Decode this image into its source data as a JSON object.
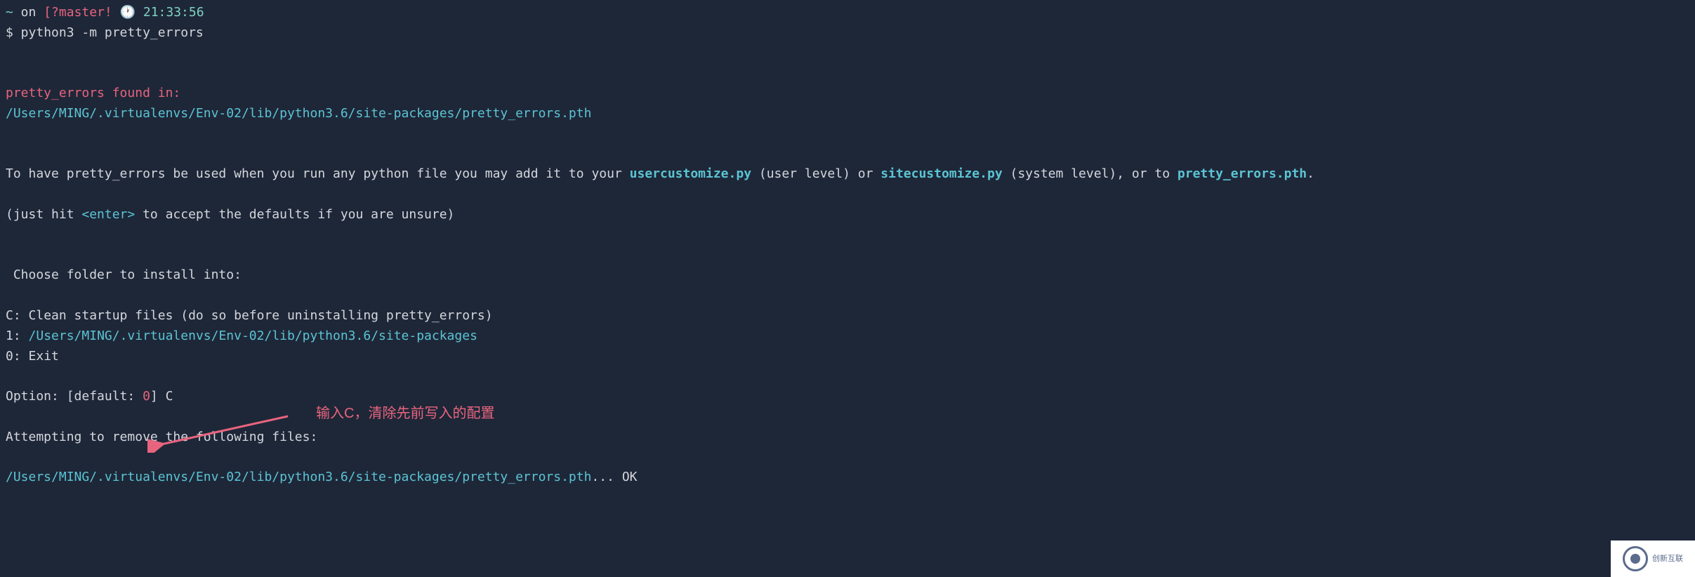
{
  "prompt": {
    "tilde": "~",
    "on": " on ",
    "branch_open": "[?",
    "branch": "master!",
    "time": "21:33:56",
    "dollar": "$",
    "command": " python3 -m pretty_errors"
  },
  "found_header": "pretty_errors found in:",
  "found_path": "/Users/MING/.virtualenvs/Env-02/lib/python3.6/site-packages/pretty_errors.pth",
  "help": {
    "prefix": "To have pretty_errors be used when you run any python file you may add it to your ",
    "usercustomize": "usercustomize.py",
    "mid1": " (user level) or ",
    "sitecustomize": "sitecustomize.py",
    "mid2": " (system level), or to ",
    "pretty_errors_pth": "pretty_errors.pth",
    "suffix": "."
  },
  "hint": {
    "prefix": "(just hit ",
    "enter": "<enter>",
    "suffix": " to accept the defaults if you are unsure)"
  },
  "choose_prompt": " Choose folder to install into:",
  "options": {
    "c_prefix": "C",
    "c_text": ": Clean startup files (do so before uninstalling pretty_errors)",
    "one_prefix": "1",
    "one_sep": ": ",
    "one_path": "/Users/MING/.virtualenvs/Env-02/lib/python3.6/site-packages",
    "zero_prefix": "0",
    "zero_text": ": Exit"
  },
  "option_input": {
    "label": "Option: ",
    "default_open": "[default: ",
    "default_val": "0",
    "default_close": "]",
    "value": " C"
  },
  "attempting": "Attempting to remove the following files:",
  "result": {
    "path": "/Users/MING/.virtualenvs/Env-02/lib/python3.6/site-packages/pretty_errors.pth",
    "dots": "... ",
    "ok": "OK"
  },
  "annotation": "输入C，清除先前写入的配置",
  "watermark": "创新互联"
}
